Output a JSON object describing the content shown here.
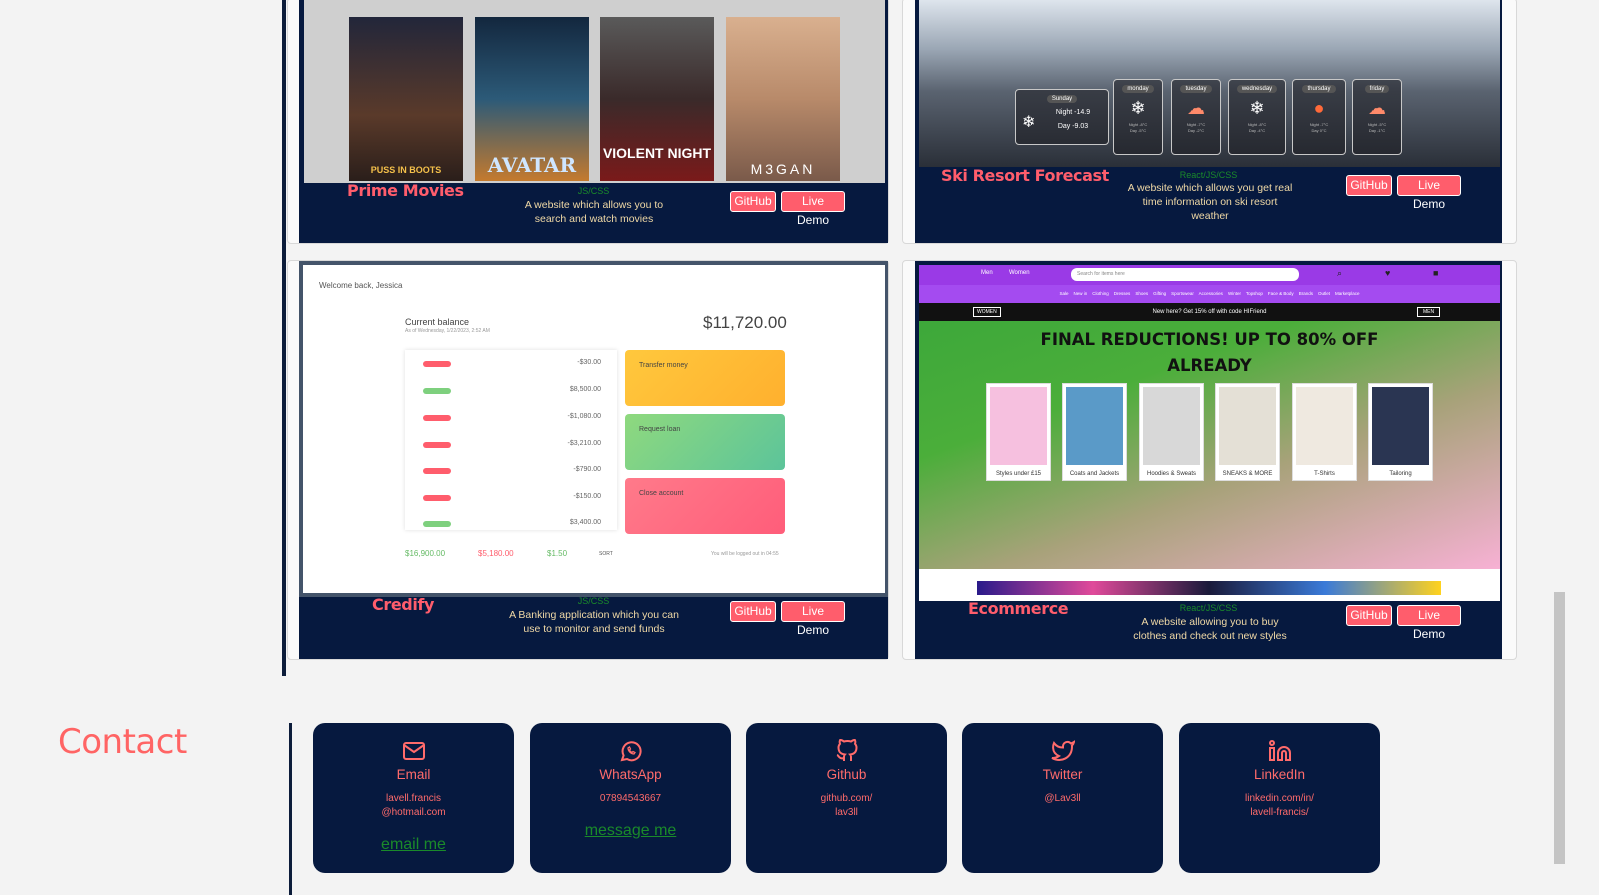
{
  "projects": [
    {
      "title": "Prime Movies",
      "tech": "JS/CSS",
      "description": "A website which allows you to search and watch movies",
      "github": "GitHub",
      "demo": "Live Demo",
      "posters": [
        "PUSS IN BOOTS",
        "AVATAR",
        "VIOLENT NIGHT",
        "M3GAN"
      ]
    },
    {
      "title": "Ski Resort Forecast",
      "tech": "React/JS/CSS",
      "description": "A website which allows you get real time information on ski resort weather",
      "github": "GitHub",
      "demo": "Live Demo",
      "today": {
        "day": "Sunday",
        "night": "Night -14.9",
        "dayTemp": "Day -9.03"
      },
      "days": [
        "monday",
        "tuesday",
        "wednesday",
        "thursday",
        "friday"
      ]
    },
    {
      "title": "Credify",
      "tech": "JS/CSS",
      "description": "A Banking application which you can use to monitor and send funds",
      "github": "GitHub",
      "demo": "Live Demo",
      "welcome": "Welcome back, Jessica",
      "balance_label": "Current balance",
      "balance_date": "As of Wednesday, 1/22/2023, 2:52 AM",
      "balance": "$11,720.00",
      "movements": [
        "-$30.00",
        "$8,500.00",
        "-$1,080.00",
        "-$3,210.00",
        "-$790.00",
        "-$150.00",
        "$3,400.00"
      ],
      "tiles": [
        "Transfer money",
        "Request loan",
        "Close account"
      ],
      "summary_in": "$16,900.00",
      "summary_out": "$5,180.00",
      "summary_interest": "$1.50",
      "sort": "SORT",
      "logout": "You will be logged out in 04:55"
    },
    {
      "title": "Ecommerce",
      "tech": "React/JS/CSS",
      "description": "A website allowing you to buy clothes and check out new styles",
      "github": "GitHub",
      "demo": "Live Demo",
      "nav": [
        "Men",
        "Women"
      ],
      "search_placeholder": "Search for items here",
      "categories": [
        "Sale",
        "New in",
        "Clothing",
        "Dresses",
        "Shoes",
        "Gifting",
        "Sportswear",
        "Accessories",
        "Winter",
        "Topshop",
        "Face & Body",
        "Brands",
        "Outlet",
        "Marketplace"
      ],
      "promo": "New here? Get 15% off with code HIFriend",
      "women": "WOMEN",
      "men": "MEN",
      "headline": "FINAL REDUCTIONS! UP TO 80% OFF ALREADY",
      "tiles": [
        "Styles under £15",
        "Coats and Jackets",
        "Hoodies & Sweats",
        "SNEAKS & MORE",
        "T-Shirts",
        "Tailoring"
      ]
    }
  ],
  "contact": {
    "title": "Contact",
    "cards": [
      {
        "label": "Email",
        "value_line1": "lavell.francis",
        "value_line2": "@hotmail.com",
        "link": "email me",
        "icon": "mail-icon"
      },
      {
        "label": "WhatsApp",
        "value_line1": "07894543667",
        "value_line2": "",
        "link": "message me",
        "icon": "whatsapp-icon"
      },
      {
        "label": "Github",
        "value_line1": "github.com/",
        "value_line2": "lav3ll",
        "link": "",
        "icon": "github-icon"
      },
      {
        "label": "Twitter",
        "value_line1": "@Lav3ll",
        "value_line2": "",
        "link": "",
        "icon": "twitter-icon"
      },
      {
        "label": "LinkedIn",
        "value_line1": "linkedin.com/in/",
        "value_line2": "lavell-francis/",
        "link": "",
        "icon": "linkedin-icon"
      }
    ]
  },
  "colors": {
    "navy": "#06193f",
    "coral": "#ff5d6c",
    "green": "#1a8a2a",
    "cream": "#f0d9a6"
  }
}
